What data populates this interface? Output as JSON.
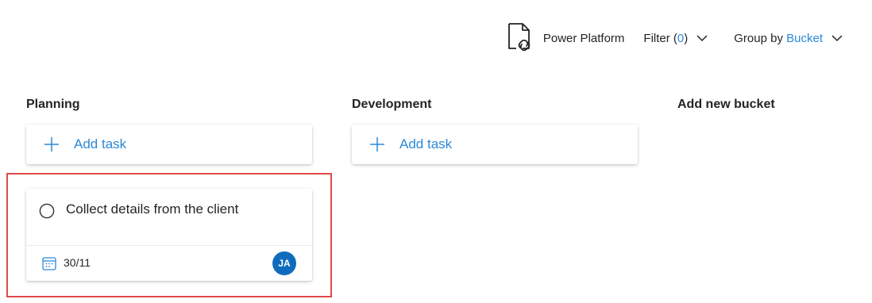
{
  "toolbar": {
    "plan_name": "Power Platform",
    "plan_icon": "plan-document-icon",
    "filter_label": "Filter (",
    "filter_count": "0",
    "filter_close": ")",
    "groupby_label": "Group by ",
    "groupby_value": "Bucket"
  },
  "buckets": [
    {
      "name": "Planning",
      "add_task_label": "Add task",
      "tasks": [
        {
          "title": "Collect details from the client",
          "due_date": "30/11",
          "assignee_initials": "JA"
        }
      ]
    },
    {
      "name": "Development",
      "add_task_label": "Add task",
      "tasks": []
    }
  ],
  "add_bucket_label": "Add new bucket",
  "colors": {
    "accent": "#2b88d8",
    "avatar": "#0f6cbd",
    "highlight": "#e04a4a"
  }
}
